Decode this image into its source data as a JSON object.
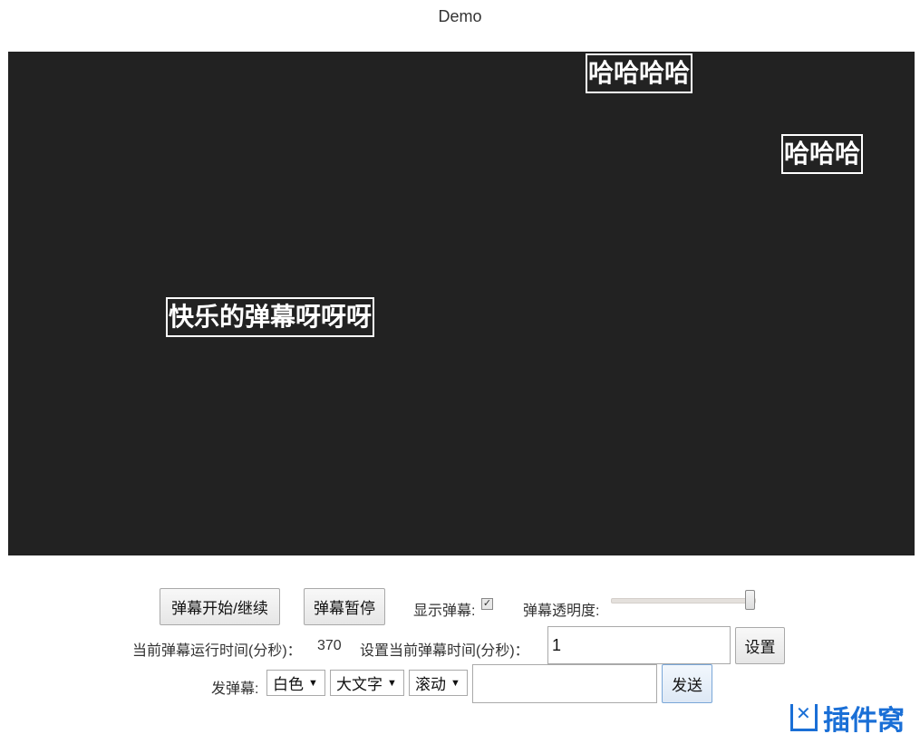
{
  "page": {
    "title": "Demo"
  },
  "stage": {
    "background": "#222222",
    "danmaku": [
      {
        "text": "哈哈哈哈"
      },
      {
        "text": "哈哈哈"
      },
      {
        "text": "快乐的弹幕呀呀呀"
      }
    ]
  },
  "controls": {
    "start_label": "弹幕开始/继续",
    "pause_label": "弹幕暂停",
    "show_label": "显示弹幕:",
    "show_checked": true,
    "opacity_label": "弹幕透明度:",
    "opacity_value": 1.0,
    "runtime_label": "当前弹幕运行时间(分秒)：",
    "runtime_value": "370",
    "set_time_label": "设置当前弹幕时间(分秒)：",
    "set_time_value": "1",
    "set_label": "设置",
    "send_label": "发弹幕:",
    "color_select": "白色",
    "size_select": "大文字",
    "mode_select": "滚动",
    "send_input_value": "",
    "send_button": "发送"
  },
  "watermark": {
    "text": "插件窝",
    "color": "#1a6fd6",
    "icon": "plugin-logo-icon"
  }
}
